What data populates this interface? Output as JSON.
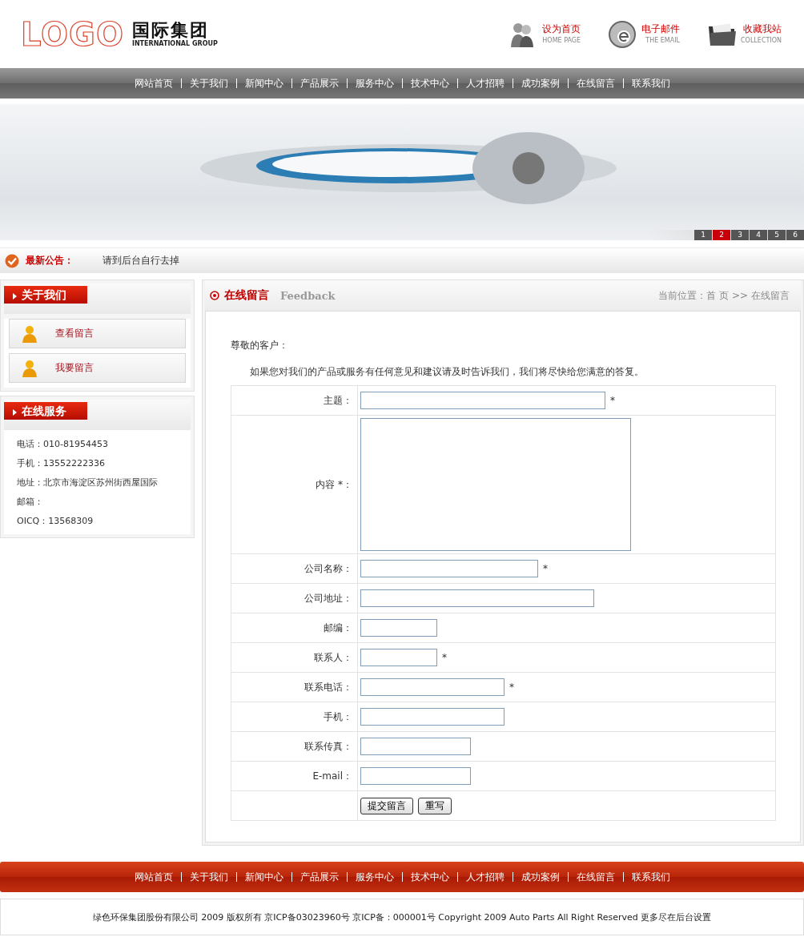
{
  "header": {
    "logo": "LOGO",
    "company": "国际集团",
    "company_en": "INTERNATIONAL GROUP",
    "links": [
      {
        "title": "设为首页",
        "subtitle": "HOME PAGE"
      },
      {
        "title": "电子邮件",
        "subtitle": "THE EMAIL"
      },
      {
        "title": "收藏我站",
        "subtitle": "COLLECTION"
      }
    ]
  },
  "nav": [
    "网站首页",
    "关于我们",
    "新闻中心",
    "产品展示",
    "服务中心",
    "技术中心",
    "人才招聘",
    "成功案例",
    "在线留言",
    "联系我们"
  ],
  "banner": {
    "slides": [
      {
        "label": "1",
        "selected": false
      },
      {
        "label": "2",
        "selected": true
      },
      {
        "label": "3",
        "selected": false
      },
      {
        "label": "4",
        "selected": false
      },
      {
        "label": "5",
        "selected": false
      },
      {
        "label": "6",
        "selected": false
      }
    ]
  },
  "notice": {
    "label": "最新公告：",
    "text": "请到后台自行去掉"
  },
  "sidebar": {
    "about": {
      "title": "关于我们",
      "items": [
        "查看留言",
        "我要留言"
      ]
    },
    "service": {
      "title": "在线服务",
      "lines": [
        "电话：010-81954453",
        "手机：13552222336",
        "地址：北京市海淀区苏州街西屋国际",
        "邮箱：",
        "OICQ：13568309"
      ]
    }
  },
  "feedback": {
    "title": "在线留言",
    "subtitle": "Feedback",
    "breadcrumb": "当前位置：首 页 >> 在线留言",
    "greeting": "尊敬的客户：",
    "intro": "如果您对我们的产品或服务有任何意见和建议请及时告诉我们，我们将尽快给您满意的答复。",
    "fields": [
      {
        "kind": "input",
        "label": "主题：",
        "note": "*"
      },
      {
        "kind": "textarea",
        "label": "内容 *："
      },
      {
        "kind": "input",
        "label": "公司名称：",
        "note": "*"
      },
      {
        "kind": "input",
        "label": "公司地址："
      },
      {
        "kind": "input",
        "label": "邮编："
      },
      {
        "kind": "input",
        "label": "联系人：",
        "note": "*"
      },
      {
        "kind": "input",
        "label": "联系电话：",
        "note": "*"
      },
      {
        "kind": "input",
        "label": "手机："
      },
      {
        "kind": "input",
        "label": "联系传真："
      },
      {
        "kind": "input",
        "label": "E-mail："
      }
    ],
    "buttons": [
      "提交留言",
      "重写"
    ]
  },
  "footer": {
    "nav": [
      "网站首页",
      "关于我们",
      "新闻中心",
      "产品展示",
      "服务中心",
      "技术中心",
      "人才招聘",
      "成功案例",
      "在线留言",
      "联系我们"
    ],
    "copyright": "绿色环保集团股份有限公司 2009 版权所有 京ICP备03023960号 京ICP备：000001号 Copyright 2009 Auto Parts All Right Reserved 更多尽在后台设置"
  }
}
